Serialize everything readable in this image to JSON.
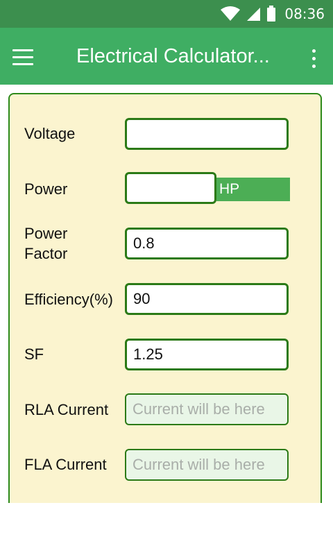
{
  "status_bar": {
    "time": "08:36",
    "icons": [
      "wifi-icon",
      "signal-icon",
      "battery-icon"
    ]
  },
  "app_bar": {
    "title": "Electrical Calculator...",
    "menu_icon": "hamburger-menu-icon",
    "more_icon": "more-vert-icon"
  },
  "form": {
    "voltage": {
      "label": "Voltage",
      "value": ""
    },
    "power": {
      "label": "Power",
      "value": "",
      "unit": "HP"
    },
    "power_factor": {
      "label_line1": "Power",
      "label_line2": "Factor",
      "value": "0.8"
    },
    "efficiency": {
      "label": "Efficiency(%)",
      "value": "90"
    },
    "sf": {
      "label": "SF",
      "value": "1.25"
    },
    "rla_current": {
      "label": "RLA Current",
      "placeholder": "Current will be here"
    },
    "fla_current": {
      "label": "FLA Current",
      "placeholder": "Current will be here"
    }
  },
  "colors": {
    "status_bar": "#3c8f4e",
    "app_bar": "#3fae63",
    "panel_bg": "#fbf4cf",
    "border": "#2b7a17",
    "unit_button": "#4cae55"
  }
}
